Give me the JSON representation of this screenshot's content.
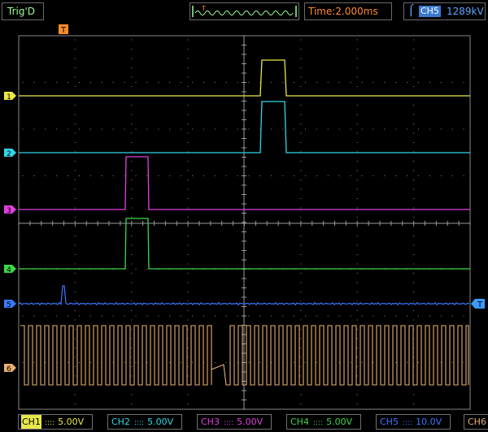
{
  "header": {
    "trigger_state": "Trig'D",
    "trigger_marker": "T",
    "timebase": "Time:2.000ms",
    "trigger_source": "CH5",
    "trigger_level": "1289kV"
  },
  "markers": {
    "trigger_position": "T",
    "trigger_level": "T"
  },
  "channels": [
    {
      "id": "1",
      "label": "CH1",
      "coupling": "::::",
      "scale": "5.00V",
      "color": "#e8e84a"
    },
    {
      "id": "2",
      "label": "CH2",
      "coupling": "::::",
      "scale": "5.00V",
      "color": "#33d6e8"
    },
    {
      "id": "3",
      "label": "CH3",
      "coupling": "::::",
      "scale": "5.00V",
      "color": "#e040e0"
    },
    {
      "id": "4",
      "label": "CH4",
      "coupling": "::::",
      "scale": "5.00V",
      "color": "#3fd64a"
    },
    {
      "id": "5",
      "label": "CH5",
      "coupling": "::::",
      "scale": "10.0V",
      "color": "#3a78ff"
    },
    {
      "id": "6",
      "label": "CH6",
      "coupling": "",
      "scale": "",
      "color": "#e8b070"
    }
  ],
  "colors": {
    "grid": "#7a7a7a",
    "screen_background": "#000000",
    "trigger_marker": "#ff8a2a",
    "ch1_selected_bg": "#e8e84a"
  }
}
